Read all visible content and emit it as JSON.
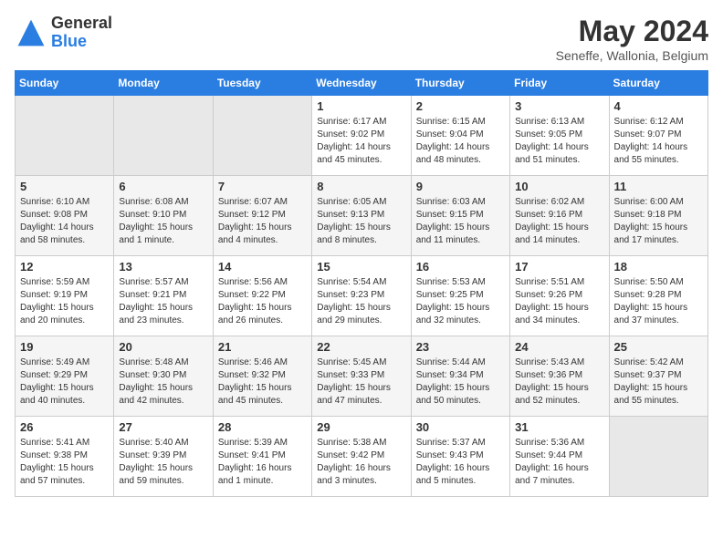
{
  "header": {
    "logo_general": "General",
    "logo_blue": "Blue",
    "title": "May 2024",
    "location": "Seneffe, Wallonia, Belgium"
  },
  "weekdays": [
    "Sunday",
    "Monday",
    "Tuesday",
    "Wednesday",
    "Thursday",
    "Friday",
    "Saturday"
  ],
  "weeks": [
    [
      {
        "day": "",
        "empty": true
      },
      {
        "day": "",
        "empty": true
      },
      {
        "day": "",
        "empty": true
      },
      {
        "day": "1",
        "sunrise": "6:17 AM",
        "sunset": "9:02 PM",
        "daylight": "14 hours and 45 minutes."
      },
      {
        "day": "2",
        "sunrise": "6:15 AM",
        "sunset": "9:04 PM",
        "daylight": "14 hours and 48 minutes."
      },
      {
        "day": "3",
        "sunrise": "6:13 AM",
        "sunset": "9:05 PM",
        "daylight": "14 hours and 51 minutes."
      },
      {
        "day": "4",
        "sunrise": "6:12 AM",
        "sunset": "9:07 PM",
        "daylight": "14 hours and 55 minutes."
      }
    ],
    [
      {
        "day": "5",
        "sunrise": "6:10 AM",
        "sunset": "9:08 PM",
        "daylight": "14 hours and 58 minutes."
      },
      {
        "day": "6",
        "sunrise": "6:08 AM",
        "sunset": "9:10 PM",
        "daylight": "15 hours and 1 minute."
      },
      {
        "day": "7",
        "sunrise": "6:07 AM",
        "sunset": "9:12 PM",
        "daylight": "15 hours and 4 minutes."
      },
      {
        "day": "8",
        "sunrise": "6:05 AM",
        "sunset": "9:13 PM",
        "daylight": "15 hours and 8 minutes."
      },
      {
        "day": "9",
        "sunrise": "6:03 AM",
        "sunset": "9:15 PM",
        "daylight": "15 hours and 11 minutes."
      },
      {
        "day": "10",
        "sunrise": "6:02 AM",
        "sunset": "9:16 PM",
        "daylight": "15 hours and 14 minutes."
      },
      {
        "day": "11",
        "sunrise": "6:00 AM",
        "sunset": "9:18 PM",
        "daylight": "15 hours and 17 minutes."
      }
    ],
    [
      {
        "day": "12",
        "sunrise": "5:59 AM",
        "sunset": "9:19 PM",
        "daylight": "15 hours and 20 minutes."
      },
      {
        "day": "13",
        "sunrise": "5:57 AM",
        "sunset": "9:21 PM",
        "daylight": "15 hours and 23 minutes."
      },
      {
        "day": "14",
        "sunrise": "5:56 AM",
        "sunset": "9:22 PM",
        "daylight": "15 hours and 26 minutes."
      },
      {
        "day": "15",
        "sunrise": "5:54 AM",
        "sunset": "9:23 PM",
        "daylight": "15 hours and 29 minutes."
      },
      {
        "day": "16",
        "sunrise": "5:53 AM",
        "sunset": "9:25 PM",
        "daylight": "15 hours and 32 minutes."
      },
      {
        "day": "17",
        "sunrise": "5:51 AM",
        "sunset": "9:26 PM",
        "daylight": "15 hours and 34 minutes."
      },
      {
        "day": "18",
        "sunrise": "5:50 AM",
        "sunset": "9:28 PM",
        "daylight": "15 hours and 37 minutes."
      }
    ],
    [
      {
        "day": "19",
        "sunrise": "5:49 AM",
        "sunset": "9:29 PM",
        "daylight": "15 hours and 40 minutes."
      },
      {
        "day": "20",
        "sunrise": "5:48 AM",
        "sunset": "9:30 PM",
        "daylight": "15 hours and 42 minutes."
      },
      {
        "day": "21",
        "sunrise": "5:46 AM",
        "sunset": "9:32 PM",
        "daylight": "15 hours and 45 minutes."
      },
      {
        "day": "22",
        "sunrise": "5:45 AM",
        "sunset": "9:33 PM",
        "daylight": "15 hours and 47 minutes."
      },
      {
        "day": "23",
        "sunrise": "5:44 AM",
        "sunset": "9:34 PM",
        "daylight": "15 hours and 50 minutes."
      },
      {
        "day": "24",
        "sunrise": "5:43 AM",
        "sunset": "9:36 PM",
        "daylight": "15 hours and 52 minutes."
      },
      {
        "day": "25",
        "sunrise": "5:42 AM",
        "sunset": "9:37 PM",
        "daylight": "15 hours and 55 minutes."
      }
    ],
    [
      {
        "day": "26",
        "sunrise": "5:41 AM",
        "sunset": "9:38 PM",
        "daylight": "15 hours and 57 minutes."
      },
      {
        "day": "27",
        "sunrise": "5:40 AM",
        "sunset": "9:39 PM",
        "daylight": "15 hours and 59 minutes."
      },
      {
        "day": "28",
        "sunrise": "5:39 AM",
        "sunset": "9:41 PM",
        "daylight": "16 hours and 1 minute."
      },
      {
        "day": "29",
        "sunrise": "5:38 AM",
        "sunset": "9:42 PM",
        "daylight": "16 hours and 3 minutes."
      },
      {
        "day": "30",
        "sunrise": "5:37 AM",
        "sunset": "9:43 PM",
        "daylight": "16 hours and 5 minutes."
      },
      {
        "day": "31",
        "sunrise": "5:36 AM",
        "sunset": "9:44 PM",
        "daylight": "16 hours and 7 minutes."
      },
      {
        "day": "",
        "empty": true
      }
    ]
  ]
}
